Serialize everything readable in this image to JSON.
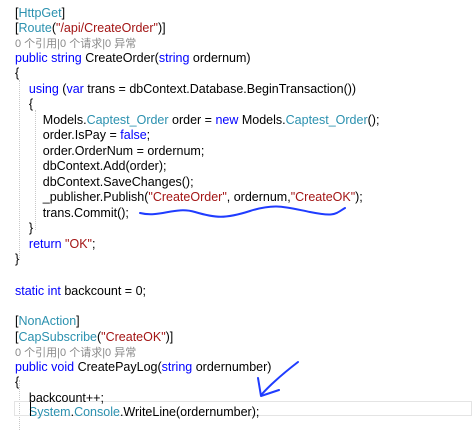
{
  "editor": {
    "lines": [
      {
        "segments": [
          {
            "t": "[",
            "c": "pl"
          },
          {
            "t": "HttpGet",
            "c": "ty"
          },
          {
            "t": "]",
            "c": "pl"
          }
        ]
      },
      {
        "segments": [
          {
            "t": "[",
            "c": "pl"
          },
          {
            "t": "Route",
            "c": "ty"
          },
          {
            "t": "(",
            "c": "pl"
          },
          {
            "t": "\"/api/CreateOrder\"",
            "c": "st"
          },
          {
            "t": ")]",
            "c": "pl"
          }
        ]
      },
      {
        "segments": [
          {
            "t": "0 个引用|0 个请求|0 异常",
            "c": "codelens"
          }
        ]
      },
      {
        "segments": [
          {
            "t": "public",
            "c": "kw"
          },
          {
            "t": " ",
            "c": "pl"
          },
          {
            "t": "string",
            "c": "kw"
          },
          {
            "t": " CreateOrder(",
            "c": "pl"
          },
          {
            "t": "string",
            "c": "kw"
          },
          {
            "t": " ordernum)",
            "c": "pl"
          }
        ]
      },
      {
        "segments": [
          {
            "t": "{",
            "c": "pl"
          }
        ]
      },
      {
        "segments": [
          {
            "t": "    ",
            "c": "pl"
          },
          {
            "t": "using",
            "c": "kw"
          },
          {
            "t": " (",
            "c": "pl"
          },
          {
            "t": "var",
            "c": "kw"
          },
          {
            "t": " trans = dbContext.Database.BeginTransaction())",
            "c": "pl"
          }
        ]
      },
      {
        "segments": [
          {
            "t": "    {",
            "c": "pl"
          }
        ]
      },
      {
        "segments": [
          {
            "t": "        Models.",
            "c": "pl"
          },
          {
            "t": "Captest_Order",
            "c": "ty"
          },
          {
            "t": " order = ",
            "c": "pl"
          },
          {
            "t": "new",
            "c": "kw"
          },
          {
            "t": " Models.",
            "c": "pl"
          },
          {
            "t": "Captest_Order",
            "c": "ty"
          },
          {
            "t": "();",
            "c": "pl"
          }
        ]
      },
      {
        "segments": [
          {
            "t": "        order.IsPay = ",
            "c": "pl"
          },
          {
            "t": "false",
            "c": "kw"
          },
          {
            "t": ";",
            "c": "pl"
          }
        ]
      },
      {
        "segments": [
          {
            "t": "        order.OrderNum = ordernum;",
            "c": "pl"
          }
        ]
      },
      {
        "segments": [
          {
            "t": "        dbContext.Add(order);",
            "c": "pl"
          }
        ]
      },
      {
        "segments": [
          {
            "t": "        dbContext.SaveChanges();",
            "c": "pl"
          }
        ]
      },
      {
        "segments": [
          {
            "t": "        _publisher.Publish(",
            "c": "pl"
          },
          {
            "t": "\"CreateOrder\"",
            "c": "st"
          },
          {
            "t": ", ordernum,",
            "c": "pl"
          },
          {
            "t": "\"CreateOK\"",
            "c": "st"
          },
          {
            "t": ");",
            "c": "pl"
          }
        ]
      },
      {
        "segments": [
          {
            "t": "        trans.Commit();",
            "c": "pl"
          }
        ]
      },
      {
        "segments": [
          {
            "t": "    }",
            "c": "pl"
          }
        ]
      },
      {
        "segments": [
          {
            "t": "    ",
            "c": "pl"
          },
          {
            "t": "return",
            "c": "kw"
          },
          {
            "t": " ",
            "c": "pl"
          },
          {
            "t": "\"OK\"",
            "c": "st"
          },
          {
            "t": ";",
            "c": "pl"
          }
        ]
      },
      {
        "segments": [
          {
            "t": "}",
            "c": "pl"
          }
        ]
      },
      {
        "segments": []
      },
      {
        "segments": [
          {
            "t": "static",
            "c": "kw"
          },
          {
            "t": " ",
            "c": "pl"
          },
          {
            "t": "int",
            "c": "kw"
          },
          {
            "t": " backcount = 0;",
            "c": "pl"
          }
        ]
      },
      {
        "segments": []
      },
      {
        "segments": [
          {
            "t": "[",
            "c": "pl"
          },
          {
            "t": "NonAction",
            "c": "ty"
          },
          {
            "t": "]",
            "c": "pl"
          }
        ]
      },
      {
        "segments": [
          {
            "t": "[",
            "c": "pl"
          },
          {
            "t": "CapSubscribe",
            "c": "ty"
          },
          {
            "t": "(",
            "c": "pl"
          },
          {
            "t": "\"CreateOK\"",
            "c": "st"
          },
          {
            "t": ")]",
            "c": "pl"
          }
        ]
      },
      {
        "segments": [
          {
            "t": "0 个引用|0 个请求|0 异常",
            "c": "codelens"
          }
        ]
      },
      {
        "segments": [
          {
            "t": "public",
            "c": "kw"
          },
          {
            "t": " ",
            "c": "pl"
          },
          {
            "t": "void",
            "c": "kw"
          },
          {
            "t": " CreatePayLog(",
            "c": "pl"
          },
          {
            "t": "string",
            "c": "kw"
          },
          {
            "t": " ordernumber)",
            "c": "pl"
          }
        ]
      },
      {
        "segments": [
          {
            "t": "{",
            "c": "pl"
          }
        ]
      },
      {
        "segments": [
          {
            "t": "    backcount++;",
            "c": "pl"
          }
        ]
      },
      {
        "segments": [
          {
            "t": "    ",
            "c": "pl"
          },
          {
            "t": "System",
            "c": "ty"
          },
          {
            "t": ".",
            "c": "pl"
          },
          {
            "t": "Console",
            "c": "ty"
          },
          {
            "t": ".WriteLine(ordernumber);",
            "c": "pl"
          }
        ]
      }
    ]
  },
  "colors": {
    "keyword": "#0000ff",
    "type": "#2b91af",
    "string": "#a31515",
    "codelens": "#8a8a8a",
    "ink_annotation": "#1f3cff"
  },
  "annotations": [
    {
      "name": "squiggle-underline",
      "target_line": 12
    },
    {
      "name": "hand-drawn-arrow",
      "target_line": 26
    }
  ]
}
